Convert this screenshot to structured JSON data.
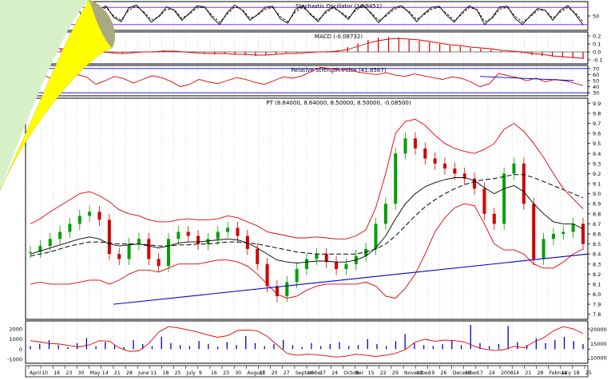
{
  "colors": {
    "background": "#ffffff",
    "panel_border": "#000000",
    "grid": "#b8b8b8",
    "price_line": "#000000",
    "bollinger": "#e00000",
    "moving_average_long": "#000000",
    "candle_up": "#00a000",
    "candle_down": "#d00000",
    "trendline": "#0000d0",
    "volume_bar": "#0000c0",
    "volume_line": "#e00000",
    "indicator_band": "#8000ff",
    "page_curl_fold": "#ffff00",
    "page_curl_under": "#d8f0c8"
  },
  "chart_data": [
    {
      "type": "line",
      "title": "Stochastic Oscillator (18.9451)",
      "y_ticks": [
        "50"
      ],
      "ylim": [
        0,
        100
      ],
      "series": [
        {
          "values": [
            55,
            82,
            74,
            30,
            60,
            88,
            90,
            40,
            22,
            70,
            85,
            45,
            30,
            78,
            88,
            60,
            28,
            50,
            82,
            70,
            35,
            60,
            85,
            82,
            45,
            20,
            62,
            88,
            70,
            35,
            55,
            80,
            84,
            40,
            25,
            72,
            86,
            55,
            30,
            66,
            82,
            62,
            38,
            76,
            88,
            58,
            26,
            55,
            78,
            86,
            62,
            30,
            58,
            80,
            84,
            52,
            28,
            62,
            86,
            70,
            20,
            45,
            82,
            84,
            42,
            20,
            50,
            76,
            70,
            35,
            70,
            86,
            55,
            19
          ]
        },
        {
          "values": [
            60,
            76,
            72,
            42,
            55,
            80,
            86,
            48,
            30,
            62,
            80,
            50,
            36,
            70,
            84,
            64,
            36,
            48,
            74,
            72,
            42,
            56,
            78,
            80,
            52,
            28,
            56,
            82,
            72,
            42,
            52,
            74,
            80,
            48,
            30,
            64,
            80,
            58,
            36,
            60,
            78,
            64,
            44,
            70,
            84,
            62,
            34,
            50,
            72,
            82,
            66,
            38,
            54,
            74,
            80,
            58,
            34,
            56,
            80,
            72,
            30,
            42,
            74,
            80,
            50,
            28,
            46,
            70,
            70,
            42,
            64,
            80,
            60,
            30
          ]
        }
      ]
    },
    {
      "type": "bar",
      "title": "MACD (-0.08732)",
      "y_ticks": [
        "0.2",
        "0.1",
        "0.0",
        "-0.1"
      ],
      "ylim": [
        -0.15,
        0.25
      ],
      "series": [
        {
          "values": [
            0.03,
            0.05,
            0.06,
            0.04,
            0.02,
            0.01,
            0.0,
            -0.01,
            -0.02,
            -0.02,
            -0.01,
            0.0,
            0.01,
            0.02,
            0.01,
            0.0,
            -0.01,
            -0.02,
            -0.03,
            -0.02,
            -0.03,
            -0.04,
            -0.05,
            -0.04,
            -0.03,
            -0.02,
            -0.01,
            0.0,
            0.0,
            0.01,
            0.02,
            0.06,
            0.11,
            0.15,
            0.18,
            0.19,
            0.18,
            0.16,
            0.14,
            0.12,
            0.1,
            0.08,
            0.07,
            0.05,
            0.04,
            0.03,
            0.01,
            0.0,
            -0.02,
            -0.04,
            -0.05,
            -0.06,
            -0.07,
            -0.08,
            -0.09
          ]
        },
        {
          "values": [
            0.02,
            0.04,
            0.05,
            0.04,
            0.03,
            0.02,
            0.01,
            0.0,
            -0.01,
            -0.02,
            -0.01,
            0.0,
            0.0,
            0.01,
            0.01,
            0.0,
            -0.01,
            -0.02,
            -0.02,
            -0.02,
            -0.03,
            -0.03,
            -0.04,
            -0.04,
            -0.03,
            -0.02,
            -0.02,
            -0.01,
            0.0,
            0.0,
            0.01,
            0.03,
            0.07,
            0.11,
            0.14,
            0.16,
            0.17,
            0.16,
            0.15,
            0.13,
            0.11,
            0.09,
            0.08,
            0.06,
            0.05,
            0.04,
            0.02,
            0.01,
            0.0,
            -0.02,
            -0.03,
            -0.05,
            -0.06,
            -0.07,
            -0.08
          ]
        }
      ]
    },
    {
      "type": "line",
      "title": "Relative Strength Index (41.8587)",
      "y_ticks": [
        "70",
        "60",
        "50",
        "40",
        "30"
      ],
      "ylim": [
        25,
        75
      ],
      "series": [
        {
          "values": [
            58,
            62,
            55,
            48,
            52,
            60,
            56,
            44,
            50,
            57,
            53,
            46,
            52,
            58,
            55,
            49,
            40,
            44,
            52,
            48,
            45,
            50,
            55,
            52,
            47,
            44,
            50,
            56,
            54,
            58,
            65,
            72,
            70,
            67,
            69,
            64,
            62,
            60,
            63,
            59,
            57,
            61,
            58,
            55,
            52,
            56,
            54,
            48,
            40,
            45,
            62,
            58,
            55,
            50,
            54,
            48,
            52,
            50,
            46,
            42
          ]
        }
      ]
    },
    {
      "type": "line",
      "title": "PT (8.64000, 8.64000, 8.50000, 8.50000, -0.08500)",
      "y_ticks": [
        "9.9",
        "9.8",
        "9.7",
        "9.6",
        "9.5",
        "9.4",
        "9.3",
        "9.2",
        "9.1",
        "9.0",
        "8.9",
        "8.8",
        "8.7",
        "8.6",
        "8.5",
        "8.4",
        "8.3",
        "8.2",
        "8.1",
        "8.0",
        "7.9",
        "7.8"
      ],
      "ylim": [
        7.75,
        9.95
      ],
      "x_labels": [
        "April",
        "10",
        "16",
        "23",
        "30",
        "May",
        "14",
        "21",
        "28",
        "June",
        "11",
        "18",
        "25",
        "July",
        "9",
        "16",
        "23",
        "30",
        "August",
        "13",
        "20",
        "27",
        "September",
        "10",
        "17",
        "24",
        "October",
        "8",
        "15",
        "22",
        "29",
        "November",
        "12",
        "19",
        "26",
        "December",
        "10",
        "17",
        "24",
        "2008",
        "14",
        "21",
        "28",
        "February",
        "11",
        "18",
        "25"
      ],
      "series": [
        {
          "values": [
            8.42,
            8.48,
            8.55,
            8.62,
            8.7,
            8.78,
            8.82,
            8.74,
            8.4,
            8.35,
            8.5,
            8.55,
            8.35,
            8.28,
            8.55,
            8.62,
            8.58,
            8.5,
            8.55,
            8.62,
            8.66,
            8.58,
            8.45,
            8.3,
            8.08,
            7.98,
            8.12,
            8.25,
            8.35,
            8.4,
            8.32,
            8.25,
            8.3,
            8.38,
            8.45,
            8.7,
            8.9,
            9.4,
            9.55,
            9.45,
            9.35,
            9.3,
            9.25,
            9.2,
            9.15,
            9.05,
            8.8,
            8.7,
            9.2,
            9.3,
            8.9,
            8.35,
            8.55,
            8.6,
            8.62,
            8.7,
            8.5
          ]
        },
        {
          "values": [
            8.4,
            8.43,
            8.46,
            8.49,
            8.52,
            8.55,
            8.57,
            8.55,
            8.5,
            8.48,
            8.49,
            8.5,
            8.48,
            8.46,
            8.48,
            8.51,
            8.52,
            8.52,
            8.53,
            8.54,
            8.55,
            8.54,
            8.51,
            8.46,
            8.4,
            8.34,
            8.32,
            8.31,
            8.32,
            8.33,
            8.33,
            8.32,
            8.32,
            8.34,
            8.38,
            8.46,
            8.58,
            8.75,
            8.9,
            9.0,
            9.07,
            9.11,
            9.14,
            9.16,
            9.16,
            9.13,
            9.06,
            9.0,
            9.05,
            9.08,
            9.02,
            8.9,
            8.8,
            8.72,
            8.7,
            8.7,
            8.65
          ]
        },
        {
          "values": [
            8.38,
            8.4,
            8.42,
            8.45,
            8.48,
            8.5,
            8.52,
            8.52,
            8.51,
            8.5,
            8.5,
            8.5,
            8.49,
            8.48,
            8.48,
            8.49,
            8.49,
            8.5,
            8.5,
            8.51,
            8.52,
            8.52,
            8.51,
            8.5,
            8.48,
            8.46,
            8.44,
            8.42,
            8.41,
            8.4,
            8.4,
            8.4,
            8.4,
            8.4,
            8.42,
            8.45,
            8.5,
            8.58,
            8.68,
            8.78,
            8.87,
            8.94,
            9.0,
            9.05,
            9.09,
            9.12,
            9.14,
            9.15,
            9.17,
            9.19,
            9.19,
            9.16,
            9.12,
            9.08,
            9.04,
            9.0,
            8.96
          ]
        },
        {
          "values": [
            8.7,
            8.75,
            8.82,
            8.88,
            8.94,
            9.0,
            9.02,
            8.98,
            8.92,
            8.84,
            8.8,
            8.78,
            8.74,
            8.72,
            8.72,
            8.74,
            8.75,
            8.74,
            8.74,
            8.75,
            8.78,
            8.76,
            8.72,
            8.68,
            8.62,
            8.6,
            8.58,
            8.56,
            8.56,
            8.57,
            8.56,
            8.55,
            8.55,
            8.58,
            8.64,
            8.86,
            9.2,
            9.6,
            9.72,
            9.74,
            9.68,
            9.58,
            9.5,
            9.45,
            9.42,
            9.4,
            9.44,
            9.5,
            9.64,
            9.7,
            9.62,
            9.5,
            9.36,
            9.2,
            9.05,
            8.95,
            8.85
          ]
        },
        {
          "values": [
            8.1,
            8.12,
            8.1,
            8.1,
            8.1,
            8.12,
            8.14,
            8.14,
            8.1,
            8.14,
            8.2,
            8.24,
            8.24,
            8.22,
            8.26,
            8.3,
            8.3,
            8.3,
            8.32,
            8.34,
            8.34,
            8.32,
            8.28,
            8.2,
            8.1,
            8.0,
            7.96,
            7.98,
            8.04,
            8.08,
            8.1,
            8.1,
            8.1,
            8.1,
            8.12,
            8.08,
            7.98,
            7.96,
            8.06,
            8.2,
            8.4,
            8.62,
            8.76,
            8.86,
            8.9,
            8.88,
            8.7,
            8.5,
            8.44,
            8.44,
            8.4,
            8.3,
            8.26,
            8.26,
            8.32,
            8.4,
            8.45
          ]
        },
        {
          "values": [
            7.9,
            8.4
          ]
        }
      ]
    },
    {
      "type": "bar",
      "title": "",
      "y_ticks": [
        "2000",
        "1000",
        "0",
        "-1000"
      ],
      "y_ticks_right": [
        "20000",
        "15000",
        "10000"
      ],
      "ylim": [
        -1400,
        2800
      ],
      "series": [
        {
          "values": [
            300,
            500,
            900,
            400,
            200,
            600,
            1100,
            300,
            700,
            400,
            200,
            900,
            500,
            300,
            1200,
            600,
            400,
            300,
            800,
            500,
            250,
            700,
            400,
            1300,
            600,
            300,
            500,
            900,
            400,
            200,
            600,
            300,
            500,
            700,
            300,
            400,
            1000,
            500,
            300,
            800,
            1500,
            600,
            400,
            300,
            500,
            900,
            400,
            2400,
            600,
            300,
            500,
            2300,
            700,
            400,
            1100,
            600,
            900,
            1200,
            800,
            500
          ]
        },
        {
          "values": [
            16000,
            15500,
            15000,
            14800,
            14200,
            13800,
            14500,
            16000,
            15800,
            13500,
            12200,
            12400,
            15000,
            19000,
            21000,
            20500,
            19800,
            19000,
            18000,
            17200,
            17800,
            19600,
            19800,
            19500,
            17500,
            14500,
            11500,
            10800,
            11200,
            11000,
            10600,
            10200,
            10500,
            11200,
            10800,
            10400,
            10800,
            11500,
            12800,
            15500,
            16500,
            15800,
            16200,
            16000,
            15500,
            14000,
            13000,
            12500,
            12800,
            14000,
            13500,
            15500,
            17000,
            19500,
            21000,
            20200,
            18500
          ]
        }
      ]
    }
  ]
}
